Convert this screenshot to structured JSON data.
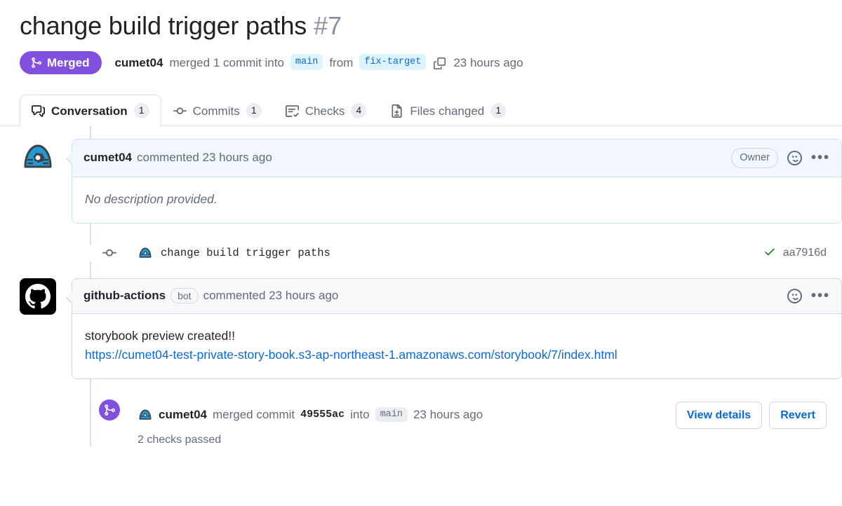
{
  "header": {
    "title": "change build trigger paths",
    "number": "#7",
    "state": "Merged",
    "state_color": "#8250df",
    "author": "cumet04",
    "merged_text": "merged 1 commit into",
    "base_branch": "main",
    "from_text": "from",
    "head_branch": "fix-target",
    "copy_icon": "copy-icon",
    "timestamp": "23 hours ago"
  },
  "tabs": [
    {
      "label": "Conversation",
      "count": "1",
      "icon": "comment-discussion-icon",
      "active": true
    },
    {
      "label": "Commits",
      "count": "1",
      "icon": "git-commit-icon",
      "active": false
    },
    {
      "label": "Checks",
      "count": "4",
      "icon": "checklist-icon",
      "active": false
    },
    {
      "label": "Files changed",
      "count": "1",
      "icon": "file-diff-icon",
      "active": false
    }
  ],
  "comments": [
    {
      "avatar": "cumet04-avatar",
      "author": "cumet04",
      "action": "commented 23 hours ago",
      "role_badge": "Owner",
      "bot_badge": null,
      "body_text": "No description provided.",
      "body_italic": true,
      "link": null,
      "reaction_icon": "smiley-icon",
      "menu_icon": "kebab-menu-icon"
    },
    {
      "avatar": "github-actions-avatar",
      "author": "github-actions",
      "action": "commented 23 hours ago",
      "role_badge": null,
      "bot_badge": "bot",
      "body_text": "storybook preview created!!",
      "body_italic": false,
      "link": "https://cumet04-test-private-story-book.s3-ap-northeast-1.amazonaws.com/storybook/7/index.html",
      "reaction_icon": "smiley-icon",
      "menu_icon": "kebab-menu-icon"
    }
  ],
  "commit_row": {
    "node_icon": "git-commit-node-icon",
    "avatar": "cumet04-avatar",
    "message": "change build trigger paths",
    "status_icon": "check-success-icon",
    "sha": "aa7916d"
  },
  "merge_event": {
    "badge_icon": "git-merge-icon",
    "badge_color": "#8250df",
    "avatar": "cumet04-avatar",
    "author": "cumet04",
    "action": "merged commit",
    "commit_sha": "49555ac",
    "into_text": "into",
    "branch": "main",
    "timestamp": "23 hours ago",
    "checks_text": "2 checks passed",
    "buttons": [
      {
        "label": "View details"
      },
      {
        "label": "Revert"
      }
    ]
  }
}
